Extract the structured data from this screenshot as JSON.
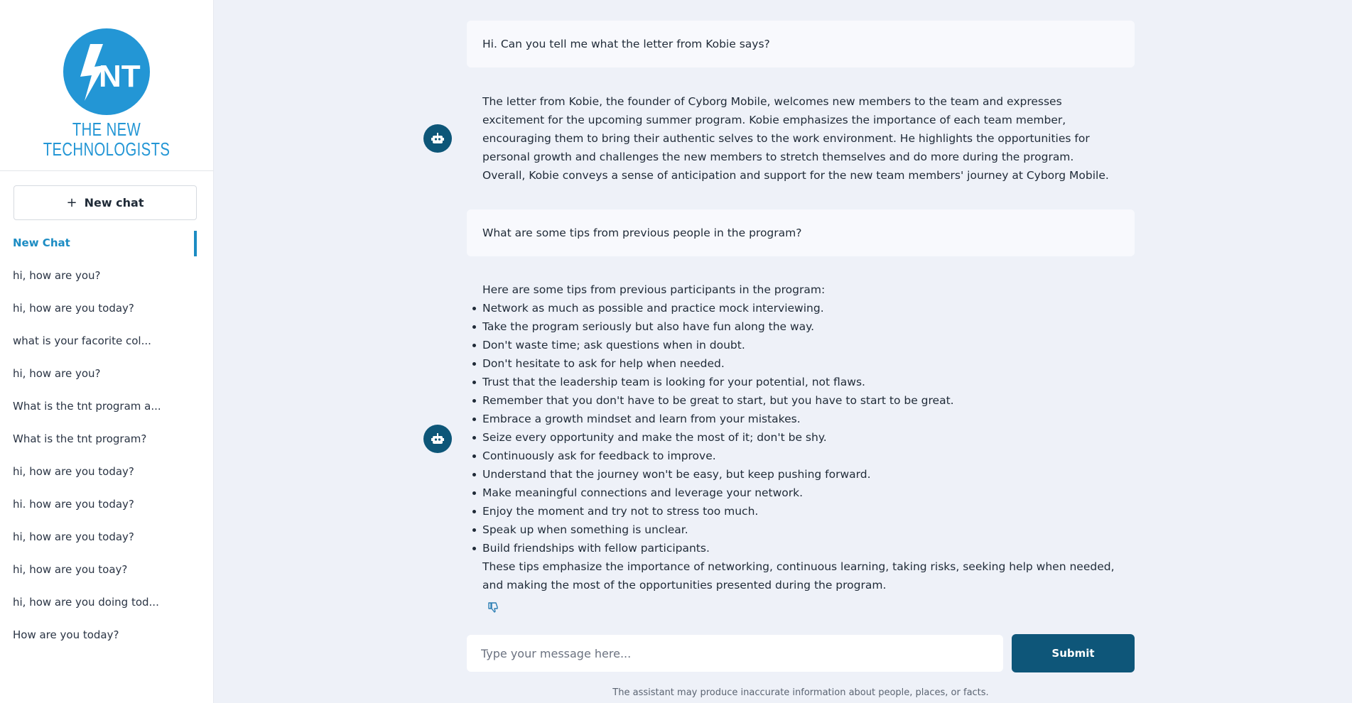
{
  "brand": {
    "logo_letters": "NT",
    "name_line1": "THE NEW",
    "name_line2": "TECHNOLOGISTS",
    "color": "#2396d5"
  },
  "sidebar": {
    "new_chat_label": "New chat",
    "new_chat_icon": "plus-icon",
    "items": [
      {
        "label": "New Chat",
        "active": true
      },
      {
        "label": "hi, how are you?"
      },
      {
        "label": "hi, how are you today?"
      },
      {
        "label": "what is your facorite col..."
      },
      {
        "label": "hi, how are you?"
      },
      {
        "label": "What is the tnt program a..."
      },
      {
        "label": "What is the tnt program?"
      },
      {
        "label": "hi, how are you today?"
      },
      {
        "label": "hi. how are you today?"
      },
      {
        "label": "hi, how are you today?"
      },
      {
        "label": "hi, how are you toay?"
      },
      {
        "label": "hi, how are you doing tod..."
      },
      {
        "label": "How are you today?"
      }
    ]
  },
  "conversation": {
    "user_msg_1": "Hi. Can you tell me what the letter from Kobie says?",
    "bot_msg_1": "The letter from Kobie, the founder of Cyborg Mobile, welcomes new members to the team and expresses excitement for the upcoming summer program. Kobie emphasizes the importance of each team member, encouraging them to bring their authentic selves to the work environment. He highlights the opportunities for personal growth and challenges the new members to stretch themselves and do more during the program. Overall, Kobie conveys a sense of anticipation and support for the new team members' journey at Cyborg Mobile.",
    "user_msg_2": "What are some tips from previous people in the program?",
    "bot_msg_2": {
      "intro": "Here are some tips from previous participants in the program:",
      "tips": [
        "Network as much as possible and practice mock interviewing.",
        "Take the program seriously but also have fun along the way.",
        "Don't waste time; ask questions when in doubt.",
        "Don't hesitate to ask for help when needed.",
        "Trust that the leadership team is looking for your potential, not flaws.",
        "Remember that you don't have to be great to start, but you have to start to be great.",
        "Embrace a growth mindset and learn from your mistakes.",
        "Seize every opportunity and make the most of it; don't be shy.",
        "Continuously ask for feedback to improve.",
        "Understand that the journey won't be easy, but keep pushing forward.",
        "Make meaningful connections and leverage your network.",
        "Enjoy the moment and try not to stress too much.",
        "Speak up when something is unclear.",
        "Build friendships with fellow participants."
      ],
      "outro": "These tips emphasize the importance of networking, continuous learning, taking risks, seeking help when needed, and making the most of the opportunities presented during the program."
    },
    "bot_avatar_icon": "robot-icon",
    "feedback_icon": "thumbs-down-icon"
  },
  "composer": {
    "placeholder": "Type your message here...",
    "value": "",
    "submit_label": "Submit",
    "submit_color": "#0e5679"
  },
  "disclaimer": "The assistant may produce inaccurate information about people, places, or facts."
}
